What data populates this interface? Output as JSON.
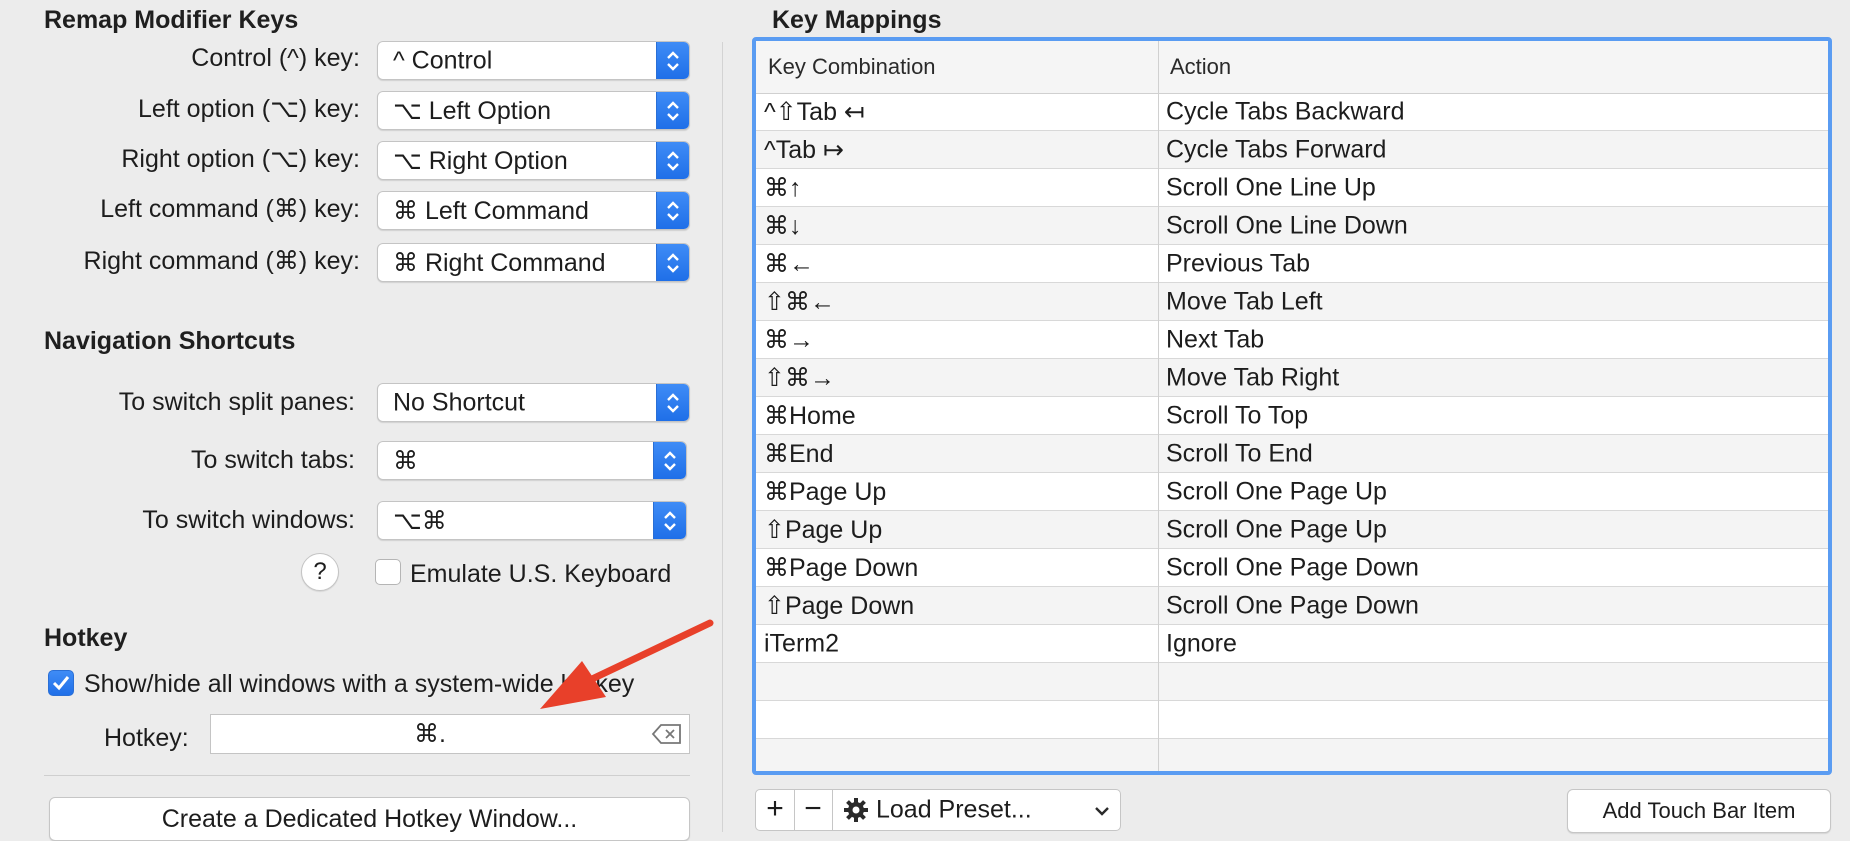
{
  "remap": {
    "title": "Remap Modifier Keys",
    "rows": [
      {
        "label": "Control (^) key:",
        "value": "^ Control"
      },
      {
        "label": "Left option (⌥) key:",
        "value": "⌥ Left Option"
      },
      {
        "label": "Right option (⌥) key:",
        "value": "⌥ Right Option"
      },
      {
        "label": "Left command (⌘) key:",
        "value": "⌘ Left Command"
      },
      {
        "label": "Right command (⌘) key:",
        "value": "⌘ Right Command"
      }
    ]
  },
  "navigation": {
    "title": "Navigation Shortcuts",
    "rows": [
      {
        "label": "To switch split panes:",
        "value": "No Shortcut"
      },
      {
        "label": "To switch tabs:",
        "value": "⌘"
      },
      {
        "label": "To switch windows:",
        "value": "⌥⌘"
      }
    ],
    "help_label": "?",
    "emulate_label": "Emulate U.S. Keyboard",
    "emulate_checked": false
  },
  "hotkey": {
    "title": "Hotkey",
    "showhide_label": "Show/hide all windows with a system-wide hotkey",
    "showhide_checked": true,
    "field_label": "Hotkey:",
    "field_value": "⌘.",
    "create_button": "Create a Dedicated Hotkey Window..."
  },
  "mappings": {
    "title": "Key Mappings",
    "columns": [
      "Key Combination",
      "Action"
    ],
    "rows": [
      {
        "key": "^⇧Tab ↤",
        "action": "Cycle Tabs Backward"
      },
      {
        "key": "^Tab ↦",
        "action": "Cycle Tabs Forward"
      },
      {
        "key": "⌘↑",
        "action": "Scroll One Line Up"
      },
      {
        "key": "⌘↓",
        "action": "Scroll One Line Down"
      },
      {
        "key": "⌘←",
        "action": "Previous Tab"
      },
      {
        "key": "⇧⌘←",
        "action": "Move Tab Left"
      },
      {
        "key": "⌘→",
        "action": "Next Tab"
      },
      {
        "key": "⇧⌘→",
        "action": "Move Tab Right"
      },
      {
        "key": "⌘Home",
        "action": "Scroll To Top"
      },
      {
        "key": "⌘End",
        "action": "Scroll To End"
      },
      {
        "key": "⌘Page Up",
        "action": "Scroll One Page Up"
      },
      {
        "key": "⇧Page Up",
        "action": "Scroll One Page Up"
      },
      {
        "key": "⌘Page Down",
        "action": "Scroll One Page Down"
      },
      {
        "key": "⇧Page Down",
        "action": "Scroll One Page Down"
      },
      {
        "key": "iTerm2",
        "action": "Ignore"
      },
      {
        "key": "",
        "action": ""
      },
      {
        "key": "",
        "action": ""
      },
      {
        "key": "",
        "action": ""
      }
    ],
    "add_label": "+",
    "remove_label": "−",
    "load_preset_label": "Load Preset...",
    "touch_bar_button": "Add Touch Bar Item"
  },
  "colors": {
    "accent": "#2a78f0",
    "table_focus": "#5a9cf2",
    "annotation_arrow": "#e8402a"
  }
}
